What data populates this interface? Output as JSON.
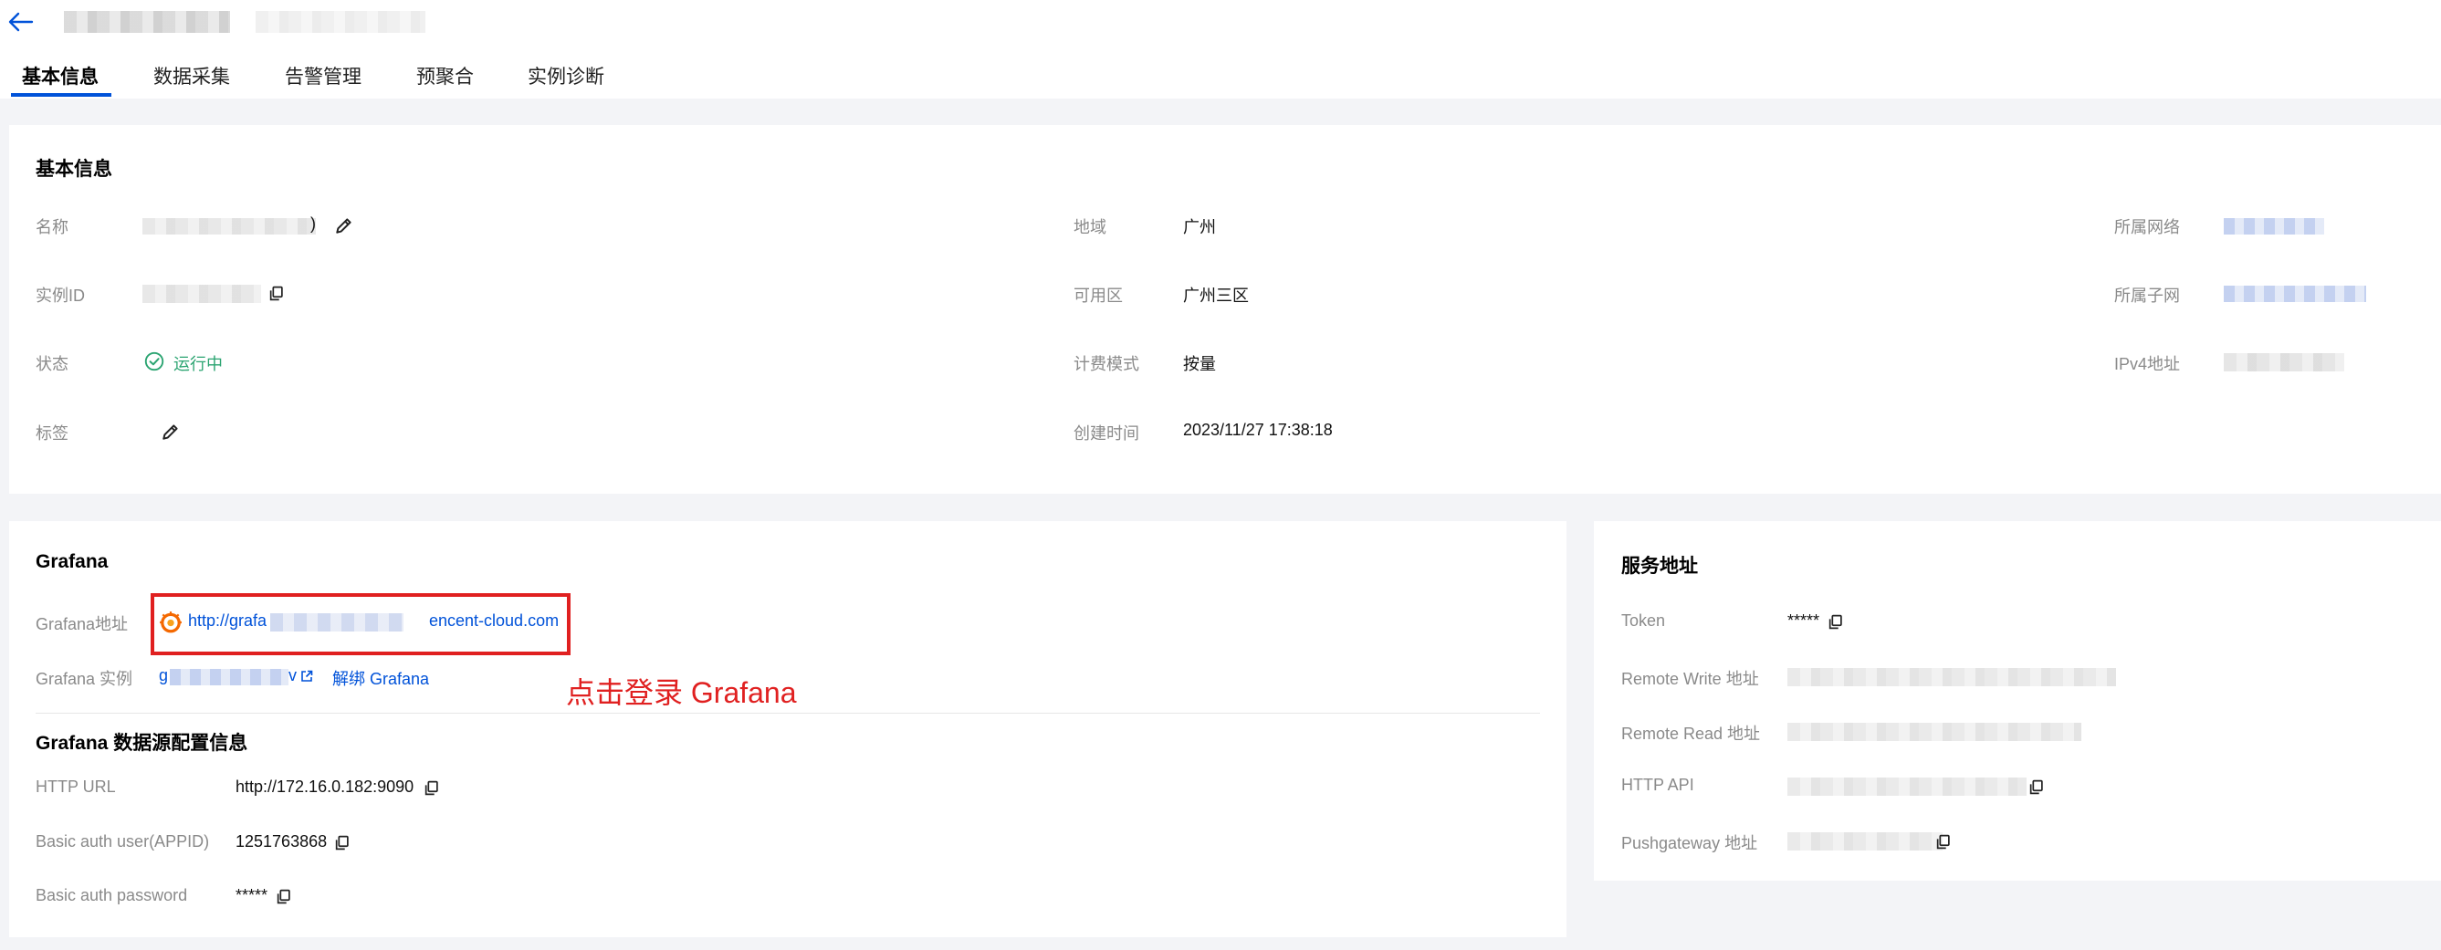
{
  "tabs": [
    {
      "label": "基本信息"
    },
    {
      "label": "数据采集"
    },
    {
      "label": "告警管理"
    },
    {
      "label": "预聚合"
    },
    {
      "label": "实例诊断"
    }
  ],
  "basic": {
    "title": "基本信息",
    "name_label": "名称",
    "name_suffix": ")",
    "instance_id_label": "实例ID",
    "status_label": "状态",
    "status_value": "运行中",
    "tags_label": "标签",
    "region_label": "地域",
    "region_value": "广州",
    "zone_label": "可用区",
    "zone_value": "广州三区",
    "billing_label": "计费模式",
    "billing_value": "按量",
    "created_label": "创建时间",
    "created_value": "2023/11/27 17:38:18",
    "vpc_label": "所属网络",
    "subnet_label": "所属子网",
    "ipv4_label": "IPv4地址"
  },
  "grafana": {
    "title": "Grafana",
    "address_label": "Grafana地址",
    "address_prefix": "http://grafa",
    "address_suffix": "encent-cloud.com",
    "instance_label": "Grafana 实例",
    "instance_prefix": "g",
    "instance_suffix": "v",
    "unbind_label": "解绑 Grafana",
    "datasource_title": "Grafana 数据源配置信息",
    "http_url_label": "HTTP URL",
    "http_url_value": "http://172.16.0.182:9090",
    "basic_user_label": "Basic auth user(APPID)",
    "basic_user_value": "1251763868",
    "basic_pass_label": "Basic auth password",
    "basic_pass_value": "*****"
  },
  "annotation": "点击登录 Grafana",
  "service": {
    "title": "服务地址",
    "token_label": "Token",
    "token_value": "*****",
    "remote_write_label": "Remote Write 地址",
    "remote_read_label": "Remote Read 地址",
    "http_api_label": "HTTP API",
    "pushgateway_label": "Pushgateway 地址"
  },
  "colors": {
    "accent": "#0052d9",
    "success": "#2ba471",
    "annotation": "#e02020"
  }
}
